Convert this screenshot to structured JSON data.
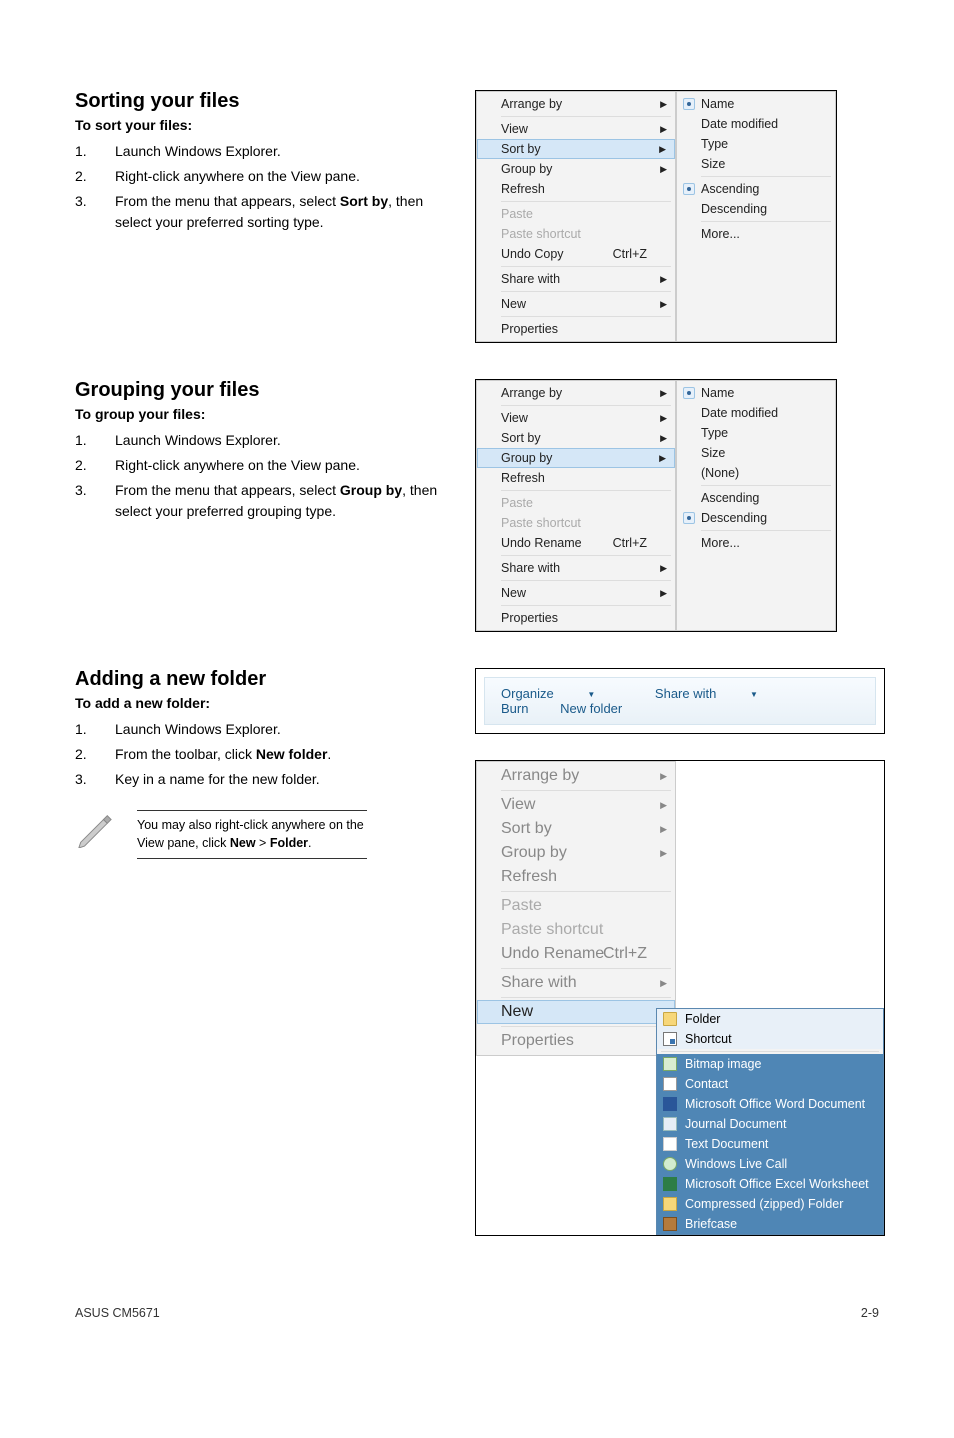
{
  "section1": {
    "heading": "Sorting your files",
    "subhead": "To sort your files:",
    "steps": {
      "s1": "Launch Windows Explorer.",
      "s2": "Right-click anywhere on the View pane.",
      "s3": "From the menu that appears, select <b>Sort by</b>, then select your preferred sorting type."
    },
    "menu": {
      "arrange": "Arrange by",
      "view": "View",
      "sortby": "Sort by",
      "groupby": "Group by",
      "refresh": "Refresh",
      "paste": "Paste",
      "pastesc": "Paste shortcut",
      "undo": "Undo Copy",
      "undokey": "Ctrl+Z",
      "share": "Share with",
      "new": "New",
      "props": "Properties",
      "sub": {
        "name": "Name",
        "date": "Date modified",
        "type": "Type",
        "size": "Size",
        "asc": "Ascending",
        "desc": "Descending",
        "more": "More..."
      }
    }
  },
  "section2": {
    "heading": "Grouping your files",
    "subhead": "To group your files:",
    "steps": {
      "s1": "Launch Windows Explorer.",
      "s2": "Right-click anywhere on the View pane.",
      "s3": "From the menu that appears, select <b>Group by</b>, then select your preferred grouping type."
    },
    "menu": {
      "arrange": "Arrange by",
      "view": "View",
      "sortby": "Sort by",
      "groupby": "Group by",
      "refresh": "Refresh",
      "paste": "Paste",
      "pastesc": "Paste shortcut",
      "undo": "Undo Rename",
      "undokey": "Ctrl+Z",
      "share": "Share with",
      "new": "New",
      "props": "Properties",
      "sub": {
        "name": "Name",
        "date": "Date modified",
        "type": "Type",
        "size": "Size",
        "none": "(None)",
        "asc": "Ascending",
        "desc": "Descending",
        "more": "More..."
      }
    }
  },
  "section3": {
    "heading": "Adding a new folder",
    "subhead": "To add a new folder:",
    "steps": {
      "s1": "Launch Windows Explorer.",
      "s2": "From the toolbar, click <b>New folder</b>.",
      "s3": "Key in a name for the new folder."
    },
    "note": "You may also right-click anywhere on the View pane, click <b>New</b> > <b>Folder</b>.",
    "toolbar": {
      "organize": "Organize",
      "sharewith": "Share with",
      "burn": "Burn",
      "newfolder": "New folder"
    },
    "menu": {
      "arrange": "Arrange by",
      "view": "View",
      "sortby": "Sort by",
      "groupby": "Group by",
      "refresh": "Refresh",
      "paste": "Paste",
      "pastesc": "Paste shortcut",
      "undo": "Undo Rename",
      "undokey": "Ctrl+Z",
      "share": "Share with",
      "new": "New",
      "props": "Properties",
      "sub": {
        "folder": "Folder",
        "shortcut": "Shortcut",
        "bmp": "Bitmap image",
        "contact": "Contact",
        "word": "Microsoft Office Word Document",
        "journal": "Journal Document",
        "text": "Text Document",
        "call": "Windows Live Call",
        "excel": "Microsoft Office Excel Worksheet",
        "zip": "Compressed (zipped) Folder",
        "brief": "Briefcase"
      }
    }
  },
  "footer": {
    "left": "ASUS CM5671",
    "right": "2-9"
  }
}
